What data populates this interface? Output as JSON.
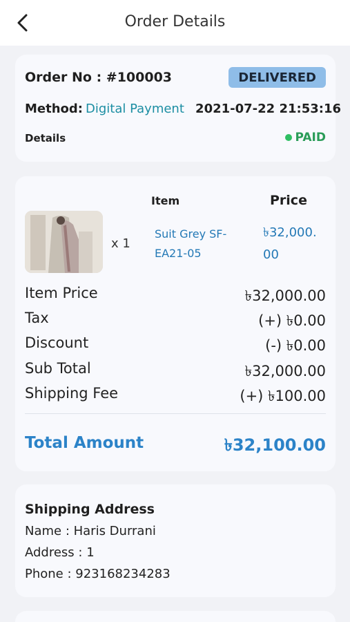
{
  "header": {
    "title": "Order Details"
  },
  "order": {
    "number_label": "Order No : #100003",
    "status": "DELIVERED",
    "method_label": "Method:",
    "method_value": "Digital Payment",
    "date": "2021-07-22 21:53:16",
    "details_label": "Details",
    "payment_status": "PAID"
  },
  "items_table": {
    "col_item": "Item",
    "col_price": "Price",
    "items": [
      {
        "qty": "x 1",
        "name_line1": "Suit Grey SF-",
        "name_line2": "EA21-05",
        "price_line1": "৳32,000.",
        "price_line2": "00"
      }
    ]
  },
  "summary": {
    "rows": [
      {
        "label": "Item Price",
        "value": "৳32,000.00"
      },
      {
        "label": "Tax",
        "value": "(+) ৳0.00"
      },
      {
        "label": "Discount",
        "value": "(-) ৳0.00"
      },
      {
        "label": "Sub Total",
        "value": "৳32,000.00"
      },
      {
        "label": "Shipping Fee",
        "value": "(+) ৳100.00"
      }
    ],
    "total_label": "Total Amount",
    "total_value": "৳32,100.00"
  },
  "shipping": {
    "title": "Shipping Address",
    "name": "Name : Haris Durrani",
    "address": "Address : 1",
    "phone": "Phone : 923168234283"
  },
  "colors": {
    "accent_blue": "#2c83c8",
    "link_teal": "#1c8ea3",
    "paid_green": "#2fbf63",
    "badge_bg": "#8fbde8"
  },
  "icons": {
    "back": "back-arrow-icon",
    "paid": "status-dot-icon"
  }
}
